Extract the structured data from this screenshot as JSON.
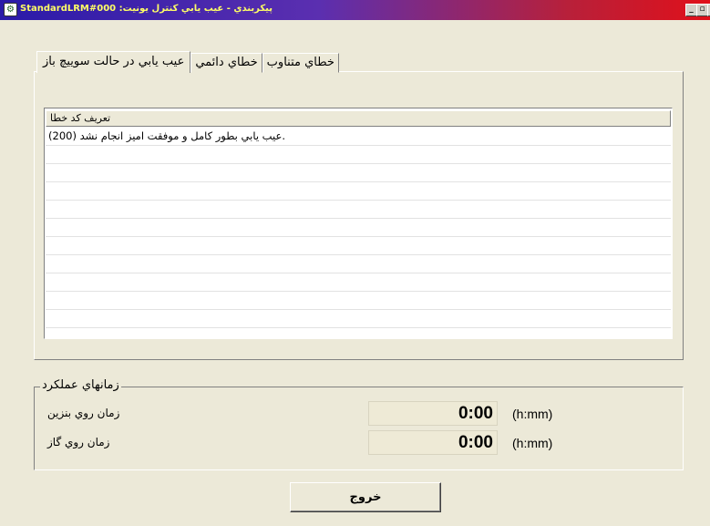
{
  "window": {
    "title": "پيکربندي - عيب يابي کنترل يونيت: StandardLRM#000",
    "icon": "app-icon",
    "min_label": "_",
    "max_label": "▫",
    "close_label": "x"
  },
  "tabs": [
    {
      "label": "خطاي متناوب",
      "active": false
    },
    {
      "label": "خطاي دائمي",
      "active": false
    },
    {
      "label": "عيب يابي در حالت سوييچ باز",
      "active": true
    }
  ],
  "list": {
    "header": "تعريف کد خطا",
    "rows": [
      "عيب يابي بطور کامل و موفقت اميز انجام نشد (200)."
    ],
    "empty_rows": 11
  },
  "group": {
    "title": "زمانهاي عملکرد",
    "items": [
      {
        "label": "زمان روي بنزين",
        "value": "0:00",
        "unit": "(h:mm)"
      },
      {
        "label": "زمان روي گاز",
        "value": "0:00",
        "unit": "(h:mm)"
      }
    ]
  },
  "exit_button": "خروج",
  "colors": {
    "face": "#ece9d8",
    "title_text": "#ffff66",
    "title_gradient_start": "#2a1aa8",
    "title_gradient_end": "#e0101a"
  }
}
